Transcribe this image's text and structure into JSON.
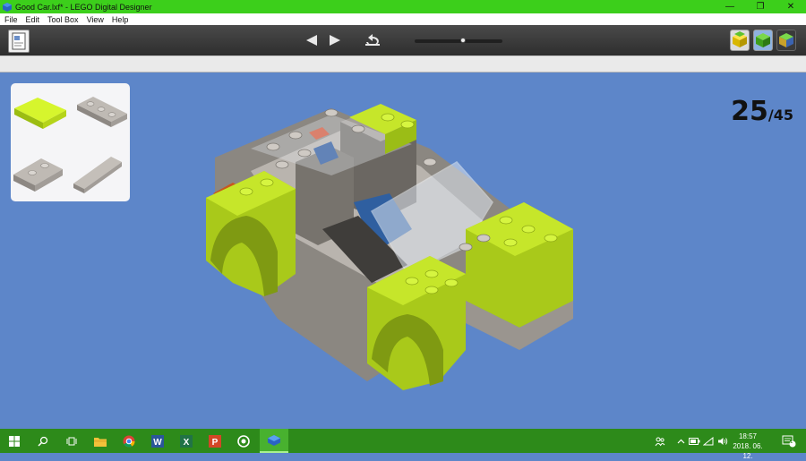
{
  "window": {
    "title": "Good Car.lxf* - LEGO Digital Designer",
    "minimize": "—",
    "restore": "❐",
    "close": "✕"
  },
  "menu": [
    "File",
    "Edit",
    "Tool Box",
    "View",
    "Help"
  ],
  "toolbar": {
    "icons": [
      "building-instructions-icon",
      "prev-step-icon",
      "next-step-icon",
      "rewind-icon",
      "build-mode-icon",
      "view-mode-icon",
      "brick-mode-icon"
    ]
  },
  "step": {
    "current": "25",
    "total": "/45",
    "progress": 0.55
  },
  "parts_panel": {
    "parts": [
      "lime-plate-2x2",
      "gray-plate-1x3",
      "gray-plate-1x2",
      "gray-tile-1x4"
    ]
  },
  "taskbar": {
    "apps": [
      "start-icon",
      "search-icon",
      "task-view-icon",
      "file-explorer-icon",
      "chrome-icon",
      "word-icon",
      "excel-icon",
      "powerpoint-icon",
      "app-circle-icon",
      "lego-digital-designer-icon"
    ],
    "clock_time": "18:57",
    "clock_date": "2018. 06. 12.",
    "notifications": "1"
  },
  "colors": {
    "titlebar": "#3ccf1b",
    "viewport": "#5d86c9",
    "lime": "#b8db1e",
    "taskbar": "#2d8a1a"
  }
}
